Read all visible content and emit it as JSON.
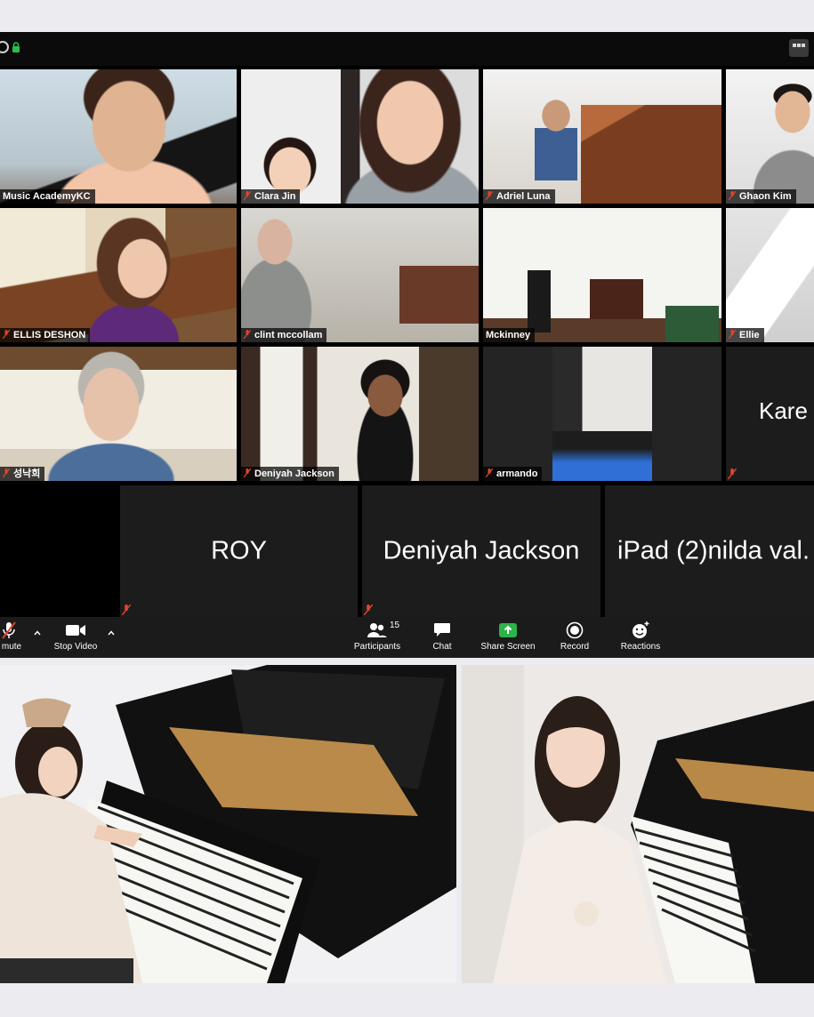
{
  "participants": [
    {
      "id": "p1",
      "name": "Music AcademyKC"
    },
    {
      "id": "p2",
      "name": "Clara Jin"
    },
    {
      "id": "p3",
      "name": "Adriel Luna"
    },
    {
      "id": "p4",
      "name": "Ghaon Kim"
    },
    {
      "id": "p5",
      "name": "ELLIS DESHON"
    },
    {
      "id": "p6",
      "name": "clint mccollam"
    },
    {
      "id": "p7",
      "name": "Mckinney"
    },
    {
      "id": "p8",
      "name": "Ellie"
    },
    {
      "id": "p9",
      "name": "성낙희"
    },
    {
      "id": "p10",
      "name": "Deniyah Jackson"
    },
    {
      "id": "p11",
      "name": "armando"
    },
    {
      "id": "p12",
      "name": "Kare"
    }
  ],
  "name_tiles": [
    {
      "name": "ROY"
    },
    {
      "name": "Deniyah Jackson"
    },
    {
      "name": "iPad (2)nilda val."
    }
  ],
  "toolbar": {
    "mute_label": "mute",
    "stop_video_label": "Stop Video",
    "participants_label": "Participants",
    "participants_count": "15",
    "chat_label": "Chat",
    "share_label": "Share Screen",
    "record_label": "Record",
    "reactions_label": "Reactions"
  },
  "colors": {
    "mic_muted": "#e0442b",
    "share_green": "#2cb34a",
    "active_speaker": "#e1e8a8",
    "background": "#ecebf0"
  }
}
